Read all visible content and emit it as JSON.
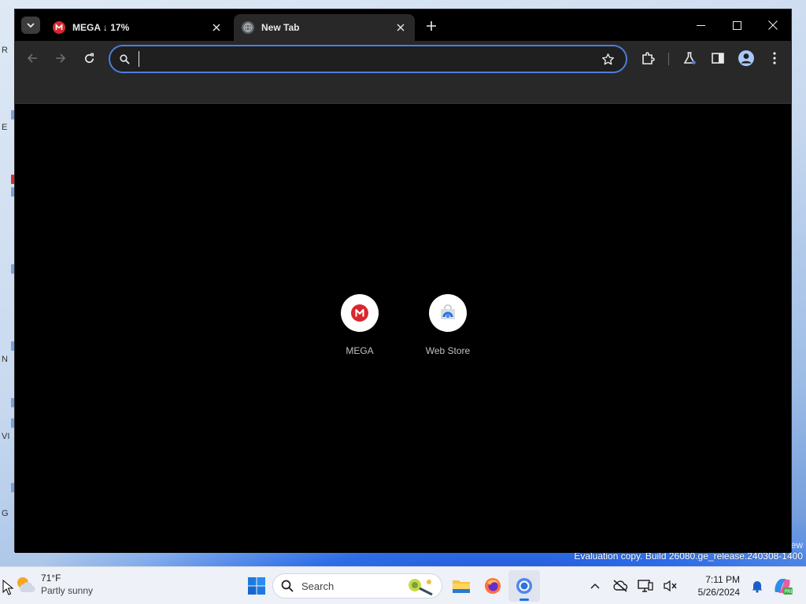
{
  "desktop": {
    "fragments": [
      "R",
      "E",
      "N",
      "VI",
      "G"
    ],
    "watermark_top": "ew",
    "watermark": "Evaluation copy. Build 26080.ge_release.240308-1400"
  },
  "browser": {
    "tabs": [
      {
        "title": "MEGA ↓ 17%",
        "favicon": "mega-icon",
        "active": false
      },
      {
        "title": "New Tab",
        "favicon": "globe-icon",
        "active": true
      }
    ],
    "omnibox": {
      "value": "",
      "placeholder": ""
    },
    "shortcuts": [
      {
        "label": "MEGA",
        "icon": "mega-icon"
      },
      {
        "label": "Web Store",
        "icon": "web-store-icon"
      }
    ],
    "colors": {
      "accent": "#4f7cdc",
      "mega": "#d9272e",
      "toolbar": "#282828",
      "content": "#000000"
    }
  },
  "taskbar": {
    "weather": {
      "temp": "71°F",
      "condition": "Partly sunny"
    },
    "search_label": "Search",
    "clock": {
      "time": "7:11 PM",
      "date": "5/26/2024"
    }
  }
}
